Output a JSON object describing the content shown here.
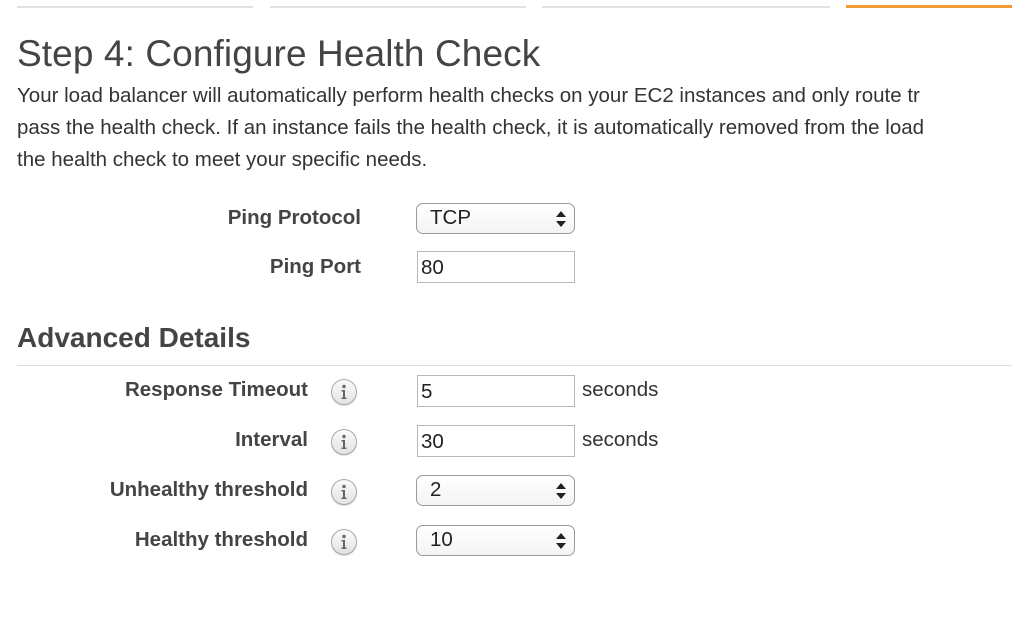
{
  "wizard": {
    "steps_visible": 4,
    "active_step_color": "#f39c37"
  },
  "step": {
    "title": "Step 4: Configure Health Check",
    "description_lines": [
      "Your load balancer will automatically perform health checks on your EC2 instances and only route tr",
      "pass the health check. If an instance fails the health check, it is automatically removed from the load",
      "the health check to meet your specific needs."
    ]
  },
  "ping": {
    "protocol_label": "Ping Protocol",
    "protocol_value": "TCP",
    "port_label": "Ping Port",
    "port_value": "80"
  },
  "advanced": {
    "title": "Advanced Details",
    "response_timeout": {
      "label": "Response Timeout",
      "value": "5",
      "unit": "seconds",
      "icon": "info-icon"
    },
    "interval": {
      "label": "Interval",
      "value": "30",
      "unit": "seconds",
      "icon": "info-icon"
    },
    "unhealthy_threshold": {
      "label": "Unhealthy threshold",
      "value": "2",
      "icon": "info-icon"
    },
    "healthy_threshold": {
      "label": "Healthy threshold",
      "value": "10",
      "icon": "info-icon"
    }
  }
}
